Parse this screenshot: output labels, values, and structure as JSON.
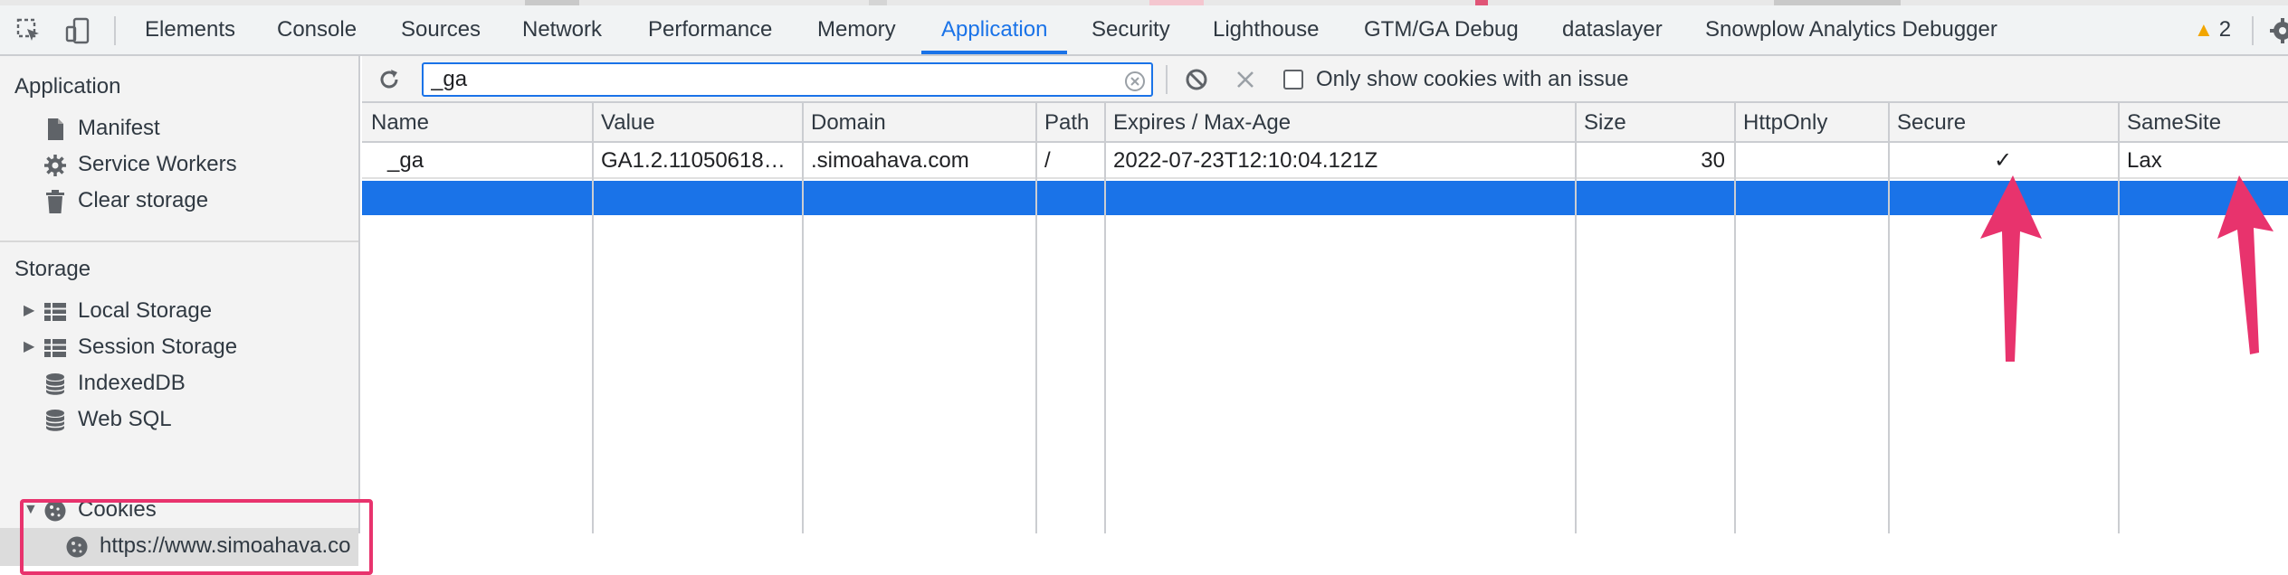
{
  "tabbar": {
    "tabs": [
      {
        "label": "Elements"
      },
      {
        "label": "Console"
      },
      {
        "label": "Sources"
      },
      {
        "label": "Network"
      },
      {
        "label": "Performance"
      },
      {
        "label": "Memory"
      },
      {
        "label": "Application"
      },
      {
        "label": "Security"
      },
      {
        "label": "Lighthouse"
      },
      {
        "label": "GTM/GA Debug"
      },
      {
        "label": "dataslayer"
      },
      {
        "label": "Snowplow Analytics Debugger"
      }
    ],
    "active_tab": "Application",
    "warning_count": "2",
    "icons": [
      "inspect-element-icon",
      "device-toolbar-icon",
      "warning-icon",
      "settings-gear-icon"
    ]
  },
  "sidebar": {
    "application_heading": "Application",
    "application_items": [
      {
        "label": "Manifest",
        "icon": "document-icon"
      },
      {
        "label": "Service Workers",
        "icon": "gear-icon"
      },
      {
        "label": "Clear storage",
        "icon": "trash-icon"
      }
    ],
    "storage_heading": "Storage",
    "storage_items": [
      {
        "label": "Local Storage",
        "icon": "grid-icon"
      },
      {
        "label": "Session Storage",
        "icon": "grid-icon"
      },
      {
        "label": "IndexedDB",
        "icon": "database-icon"
      },
      {
        "label": "Web SQL",
        "icon": "database-icon"
      },
      {
        "label": "Cookies",
        "icon": "cookie-icon"
      },
      {
        "label": "https://www.simoahava.co",
        "icon": "cookie-icon"
      }
    ]
  },
  "toolbar": {
    "filter_value": "_ga",
    "only_issues_label": "Only show cookies with an issue"
  },
  "table": {
    "headers": [
      "Name",
      "Value",
      "Domain",
      "Path",
      "Expires / Max-Age",
      "Size",
      "HttpOnly",
      "Secure",
      "SameSite"
    ],
    "rows": [
      {
        "name": "_ga",
        "value": "GA1.2.11050618…",
        "domain": ".simoahava.com",
        "path": "/",
        "expires": "2022-07-23T12:10:04.121Z",
        "size": "30",
        "httponly": "",
        "secure": "✓",
        "samesite": "Lax"
      }
    ]
  },
  "colors": {
    "accent": "#1a73e8",
    "annotation": "#e8336d",
    "warning": "#f2a600"
  }
}
